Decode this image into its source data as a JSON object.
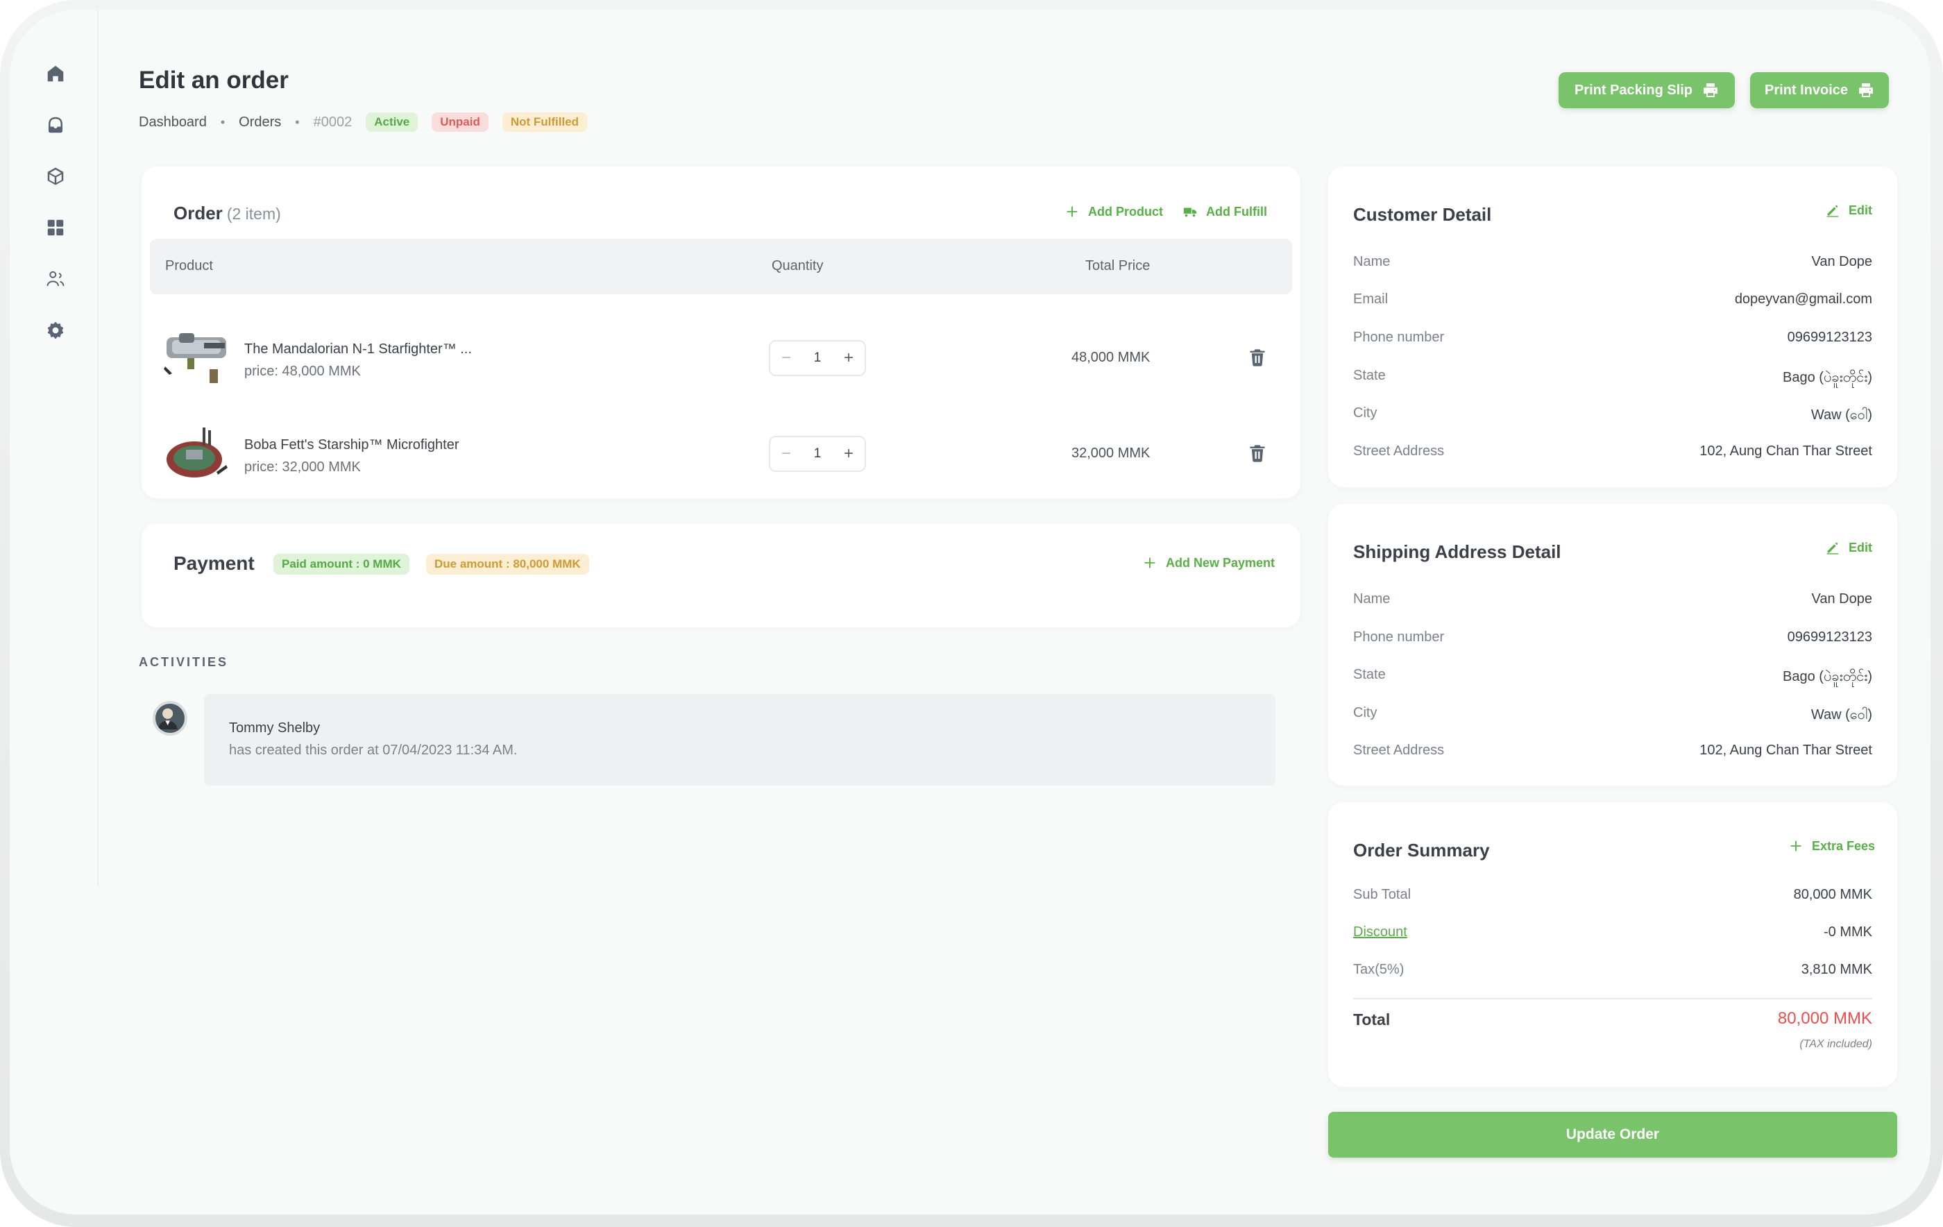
{
  "header": {
    "title": "Edit an order",
    "breadcrumb": [
      "Dashboard",
      "Orders",
      "#0002"
    ],
    "badges": {
      "status": "Active",
      "payment": "Unpaid",
      "fulfillment": "Not Fulfilled"
    },
    "print_packing_slip": "Print Packing Slip",
    "print_invoice": "Print Invoice"
  },
  "sidebar": {
    "icons": [
      "home-icon",
      "inbox-icon",
      "box-icon",
      "grid-icon",
      "users-icon",
      "settings-icon"
    ]
  },
  "order": {
    "title": "Order",
    "count": "(2 item)",
    "add_product": "Add Product",
    "add_fulfill": "Add Fulfill",
    "columns": {
      "product": "Product",
      "quantity": "Quantity",
      "total": "Total Price"
    },
    "items": [
      {
        "name": "The Mandalorian N-1 Starfighter™ ...",
        "price": "price: 48,000 MMK",
        "qty": "1",
        "total": "48,000 MMK"
      },
      {
        "name": "Boba Fett's Starship™ Microfighter",
        "price": "price: 32,000 MMK",
        "qty": "1",
        "total": "32,000 MMK"
      }
    ]
  },
  "payment": {
    "title": "Payment",
    "paid": "Paid amount : 0 MMK",
    "due": "Due amount : 80,000 MMK",
    "add_new": "Add New Payment"
  },
  "activities": {
    "label": "ACTIVITIES",
    "entries": [
      {
        "name": "Tommy Shelby",
        "description": "has created this order at 07/04/2023 11:34 AM."
      }
    ]
  },
  "customer": {
    "title": "Customer Detail",
    "edit": "Edit",
    "fields": [
      {
        "label": "Name",
        "value": "Van Dope"
      },
      {
        "label": "Email",
        "value": "dopeyvan@gmail.com"
      },
      {
        "label": "Phone number",
        "value": "09699123123"
      },
      {
        "label": "State",
        "value": "Bago (ပဲခူးတိုင်း)"
      },
      {
        "label": "City",
        "value": "Waw (ဝေါ)"
      },
      {
        "label": "Street Address",
        "value": "102, Aung Chan Thar Street"
      }
    ]
  },
  "shipping": {
    "title": "Shipping Address Detail",
    "edit": "Edit",
    "fields": [
      {
        "label": "Name",
        "value": "Van Dope"
      },
      {
        "label": "Phone number",
        "value": "09699123123"
      },
      {
        "label": "State",
        "value": "Bago (ပဲခူးတိုင်း)"
      },
      {
        "label": "City",
        "value": "Waw (ဝေါ)"
      },
      {
        "label": "Street Address",
        "value": "102, Aung Chan Thar Street"
      }
    ]
  },
  "summary": {
    "title": "Order Summary",
    "extra_fees": "Extra Fees",
    "rows": [
      {
        "label": "Sub Total",
        "value": "80,000 MMK"
      },
      {
        "label": "Discount",
        "value": "-0 MMK"
      },
      {
        "label": "Tax(5%)",
        "value": "3,810 MMK"
      }
    ],
    "total_label": "Total",
    "total_value": "80,000 MMK",
    "tax_note": "(TAX included)"
  },
  "update_button": "Update Order",
  "colors": {
    "accent": "#79c36a",
    "accent_text": "#57b046",
    "total_red": "#ee4d4d"
  }
}
